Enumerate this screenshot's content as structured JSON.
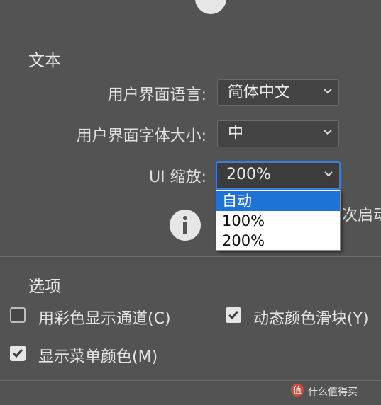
{
  "text_section": {
    "title": "文本",
    "ui_language": {
      "label": "用户界面语言:",
      "value": "简体中文"
    },
    "ui_font_size": {
      "label": "用户界面字体大小:",
      "value": "中"
    },
    "ui_scaling": {
      "label": "UI 缩放:",
      "value": "200%",
      "options": [
        "自动",
        "100%",
        "200%"
      ],
      "highlighted_option": "自动"
    },
    "notice_text_fragment": "次启动"
  },
  "options_section": {
    "title": "选项",
    "checkboxes": [
      {
        "label": "用彩色显示通道(C)",
        "checked": false
      },
      {
        "label": "动态颜色滑块(Y)",
        "checked": true
      },
      {
        "label": "显示菜单颜色(M)",
        "checked": true
      }
    ]
  },
  "watermark": {
    "text": "什么值得买"
  },
  "colors": {
    "panel": "#535353",
    "accent": "#1e73d6",
    "focus_border": "#3b7ed8"
  }
}
